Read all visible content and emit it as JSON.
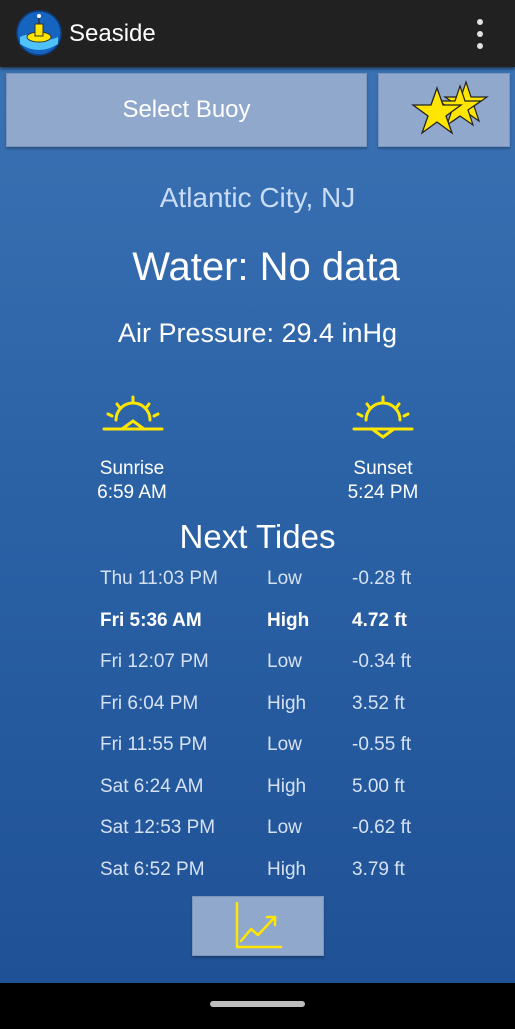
{
  "app": {
    "title": "Seaside",
    "icon": "buoy-logo-icon",
    "menu_icon": "overflow-menu-icon"
  },
  "controls": {
    "select_buoy_label": "Select Buoy",
    "favorites_icon": "star-stack-icon",
    "chart_icon": "tide-chart-icon"
  },
  "location": "Atlantic City, NJ",
  "water": "Water: No data",
  "pressure": "Air Pressure: 29.4 inHg",
  "sun": {
    "sunrise_label": "Sunrise",
    "sunrise_time": "6:59 AM",
    "sunset_label": "Sunset",
    "sunset_time": "5:24 PM",
    "icon_color": "#ffe600"
  },
  "tides": {
    "title": "Next Tides",
    "rows": [
      {
        "time": "Thu 11:03 PM",
        "type": "Low",
        "height": "-0.28 ft",
        "highlight": false
      },
      {
        "time": "Fri 5:36 AM",
        "type": "High",
        "height": "4.72 ft",
        "highlight": true
      },
      {
        "time": "Fri 12:07 PM",
        "type": "Low",
        "height": "-0.34 ft",
        "highlight": false
      },
      {
        "time": "Fri 6:04 PM",
        "type": "High",
        "height": "3.52 ft",
        "highlight": false
      },
      {
        "time": "Fri 11:55 PM",
        "type": "Low",
        "height": "-0.55 ft",
        "highlight": false
      },
      {
        "time": "Sat 6:24 AM",
        "type": "High",
        "height": "5.00 ft",
        "highlight": false
      },
      {
        "time": "Sat 12:53 PM",
        "type": "Low",
        "height": "-0.62 ft",
        "highlight": false
      },
      {
        "time": "Sat 6:52 PM",
        "type": "High",
        "height": "3.79 ft",
        "highlight": false
      }
    ]
  },
  "colors": {
    "appbar": "#212121",
    "background_top": "#3a72b4",
    "background_bottom": "#1f5196",
    "button": "#8fa8cc",
    "accent_yellow": "#ffe600",
    "city_text": "#c9dcf6"
  }
}
